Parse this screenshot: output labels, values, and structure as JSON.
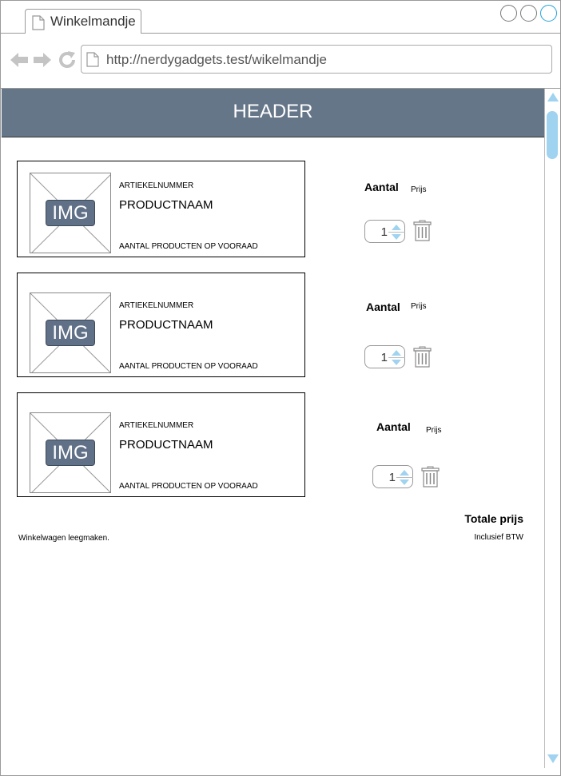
{
  "browser": {
    "tab_title": "Winkelmandje",
    "url": "http://nerdygadgets.test/wikelmandje",
    "icons": [
      "doc-icon",
      "back-arrow-icon",
      "forward-arrow-icon",
      "reload-icon"
    ],
    "accent_color": "#1ea1d9"
  },
  "header": {
    "title": "HEADER",
    "background": "#667689"
  },
  "items": [
    {
      "image_label": "IMG",
      "article_number": "ARTIEKELNUMMER",
      "product_name": "PRODUCTNAAM",
      "stock": "AANTAL PRODUCTEN OP VOORAAD",
      "quantity_label": "Aantal",
      "price_label": "Prijs",
      "quantity": "1"
    },
    {
      "image_label": "IMG",
      "article_number": "ARTIEKELNUMMER",
      "product_name": "PRODUCTNAAM",
      "stock": "AANTAL PRODUCTEN OP VOORAAD",
      "quantity_label": "Aantal",
      "price_label": "Prijs",
      "quantity": "1"
    },
    {
      "image_label": "IMG",
      "article_number": "ARTIEKELNUMMER",
      "product_name": "PRODUCTNAAM",
      "stock": "AANTAL PRODUCTEN OP VOORAAD",
      "quantity_label": "Aantal",
      "price_label": "Prijs",
      "quantity": "1"
    }
  ],
  "summary": {
    "total_label": "Totale prijs",
    "vat_note": "Inclusief BTW",
    "empty_cart": "Winkelwagen leegmaken."
  }
}
